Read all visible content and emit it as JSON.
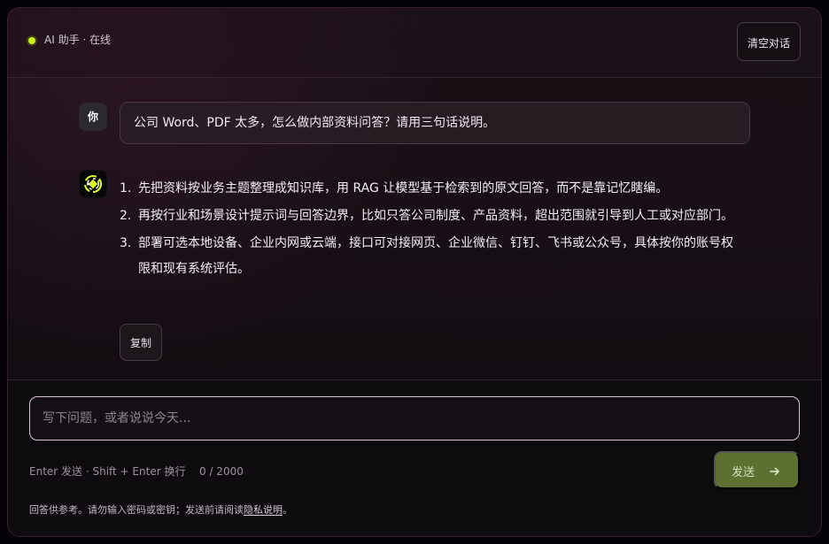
{
  "header": {
    "status_text": "AI 助手 · 在线",
    "clear_button_label": "清空对话"
  },
  "messages": {
    "user": {
      "avatar_text": "你",
      "text": "公司 Word、PDF 太多，怎么做内部资料问答？请用三句话说明。"
    },
    "assistant": {
      "icon": "assistant-logo-icon",
      "items": [
        {
          "number": "1.",
          "text": "先把资料按业务主题整理成知识库，用 RAG 让模型基于检索到的原文回答，而不是靠记忆瞎编。"
        },
        {
          "number": "2.",
          "text": "再按行业和场景设计提示词与回答边界，比如只答公司制度、产品资料，超出范围就引导到人工或对应部门。"
        },
        {
          "number": "3.",
          "text": "部署可选本地设备、企业内网或云端，接口可对接网页、企业微信、钉钉、飞书或公众号，具体按你的账号权限和现有系统评估。"
        }
      ],
      "copy_button_label": "复制"
    }
  },
  "composer": {
    "input_value": "",
    "input_placeholder": "写下问题，或者说说今天...",
    "shortcut_hint": "Enter 发送 · Shift + Enter 换行",
    "counter": "0 / 2000",
    "send_button_label": "发送",
    "send_icon": "arrow-right-icon"
  },
  "footer": {
    "disclaimer_prefix": "回答供参考。请勿输入密码或密钥；发送前请阅读",
    "privacy_link": "隐私说明",
    "disclaimer_suffix": "。"
  },
  "colors": {
    "status": "#c9f21c",
    "send_button": "#5d7032",
    "accent_border": "#d8c7d3"
  }
}
